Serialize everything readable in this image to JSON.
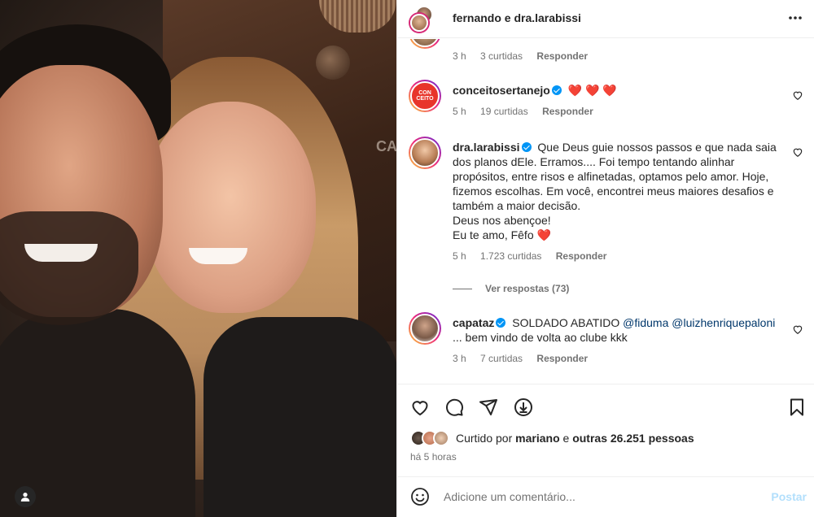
{
  "header": {
    "title": "fernando e dra.larabissi"
  },
  "comments": [
    {
      "user": "",
      "verified": false,
      "text": "",
      "time": "3 h",
      "likes": "3 curtidas",
      "reply": "Responder",
      "partial": true
    },
    {
      "user": "conceitosertanejo",
      "verified": true,
      "text": "❤️ ❤️ ❤️",
      "time": "5 h",
      "likes": "19 curtidas",
      "reply": "Responder",
      "avatar_text": "CON CEITO"
    },
    {
      "user": "dra.larabissi",
      "verified": true,
      "text": "Que Deus guie nossos passos e que nada saia dos planos dEle. Erramos.... Foi tempo tentando alinhar propósitos, entre risos e alfinetadas, optamos pelo amor. Hoje, fizemos escolhas. Em você, encontrei meus maiores desafios e também a maior decisão.",
      "text2": "Deus nos abençoe!",
      "text3": "Eu te amo, Fêfo ❤️",
      "time": "5 h",
      "likes": "1.723 curtidas",
      "reply": "Responder"
    },
    {
      "user": "capataz",
      "verified": true,
      "text_pre": "SOLDADO ABATIDO",
      "mention1": "@fiduma",
      "mention2": "@luizhenriquepaloni",
      "text_post": "... bem vindo de volta ao clube kkk",
      "time": "3 h",
      "likes": "7 curtidas",
      "reply": "Responder"
    }
  ],
  "view_replies": "Ver respostas (73)",
  "likes_line": {
    "prefix": "Curtido por",
    "user": "mariano",
    "mid": "e",
    "others": "outras 26.251 pessoas"
  },
  "post_time": "há 5 horas",
  "add_comment": {
    "placeholder": "Adicione um comentário...",
    "post_label": "Postar"
  },
  "photo": {
    "sign_text": "CA"
  },
  "icons": {
    "more": "more-options-icon",
    "like": "heart-icon",
    "comment": "comment-icon",
    "share": "send-icon",
    "download": "download-icon",
    "save": "bookmark-icon",
    "emoji": "emoji-icon",
    "tag": "user-tag-icon"
  },
  "colors": {
    "verified": "#0095f6",
    "heart": "#ed4956",
    "mention": "#00376b",
    "post_disabled": "#b2dffc"
  }
}
